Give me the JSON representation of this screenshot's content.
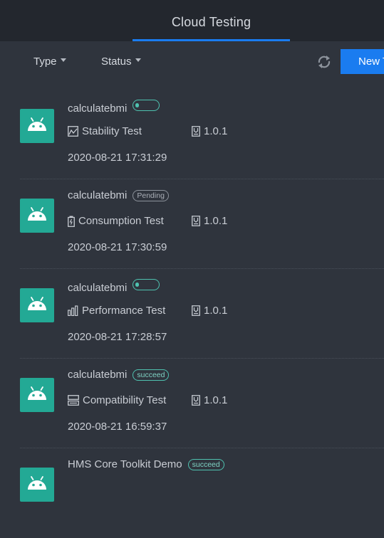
{
  "header": {
    "title": "Cloud Testing"
  },
  "toolbar": {
    "type_label": "Type",
    "status_label": "Status",
    "new_label": "New Test"
  },
  "colors": {
    "accent": "#1a7cf0",
    "avatar": "#23a995",
    "badge": "#4fc2b0"
  },
  "tasks": [
    {
      "app": "calculatebmi",
      "status": "",
      "status_kind": "running",
      "test_type": "Stability Test",
      "type_icon": "chart-icon",
      "version": "1.0.1",
      "time": "2020-08-21 17:31:29"
    },
    {
      "app": "calculatebmi",
      "status": "Pending",
      "status_kind": "pending",
      "test_type": "Consumption Test",
      "type_icon": "battery-icon",
      "version": "1.0.1",
      "time": "2020-08-21 17:30:59"
    },
    {
      "app": "calculatebmi",
      "status": "",
      "status_kind": "running",
      "test_type": "Performance Test",
      "type_icon": "bar-chart-icon",
      "version": "1.0.1",
      "time": "2020-08-21 17:28:57"
    },
    {
      "app": "calculatebmi",
      "status": "succeed",
      "status_kind": "succeed",
      "test_type": "Compatibility Test",
      "type_icon": "devices-icon",
      "version": "1.0.1",
      "time": "2020-08-21 16:59:37"
    },
    {
      "app": "HMS Core Toolkit Demo",
      "status": "succeed",
      "status_kind": "succeed",
      "test_type": "",
      "type_icon": "",
      "version": "",
      "time": ""
    }
  ]
}
